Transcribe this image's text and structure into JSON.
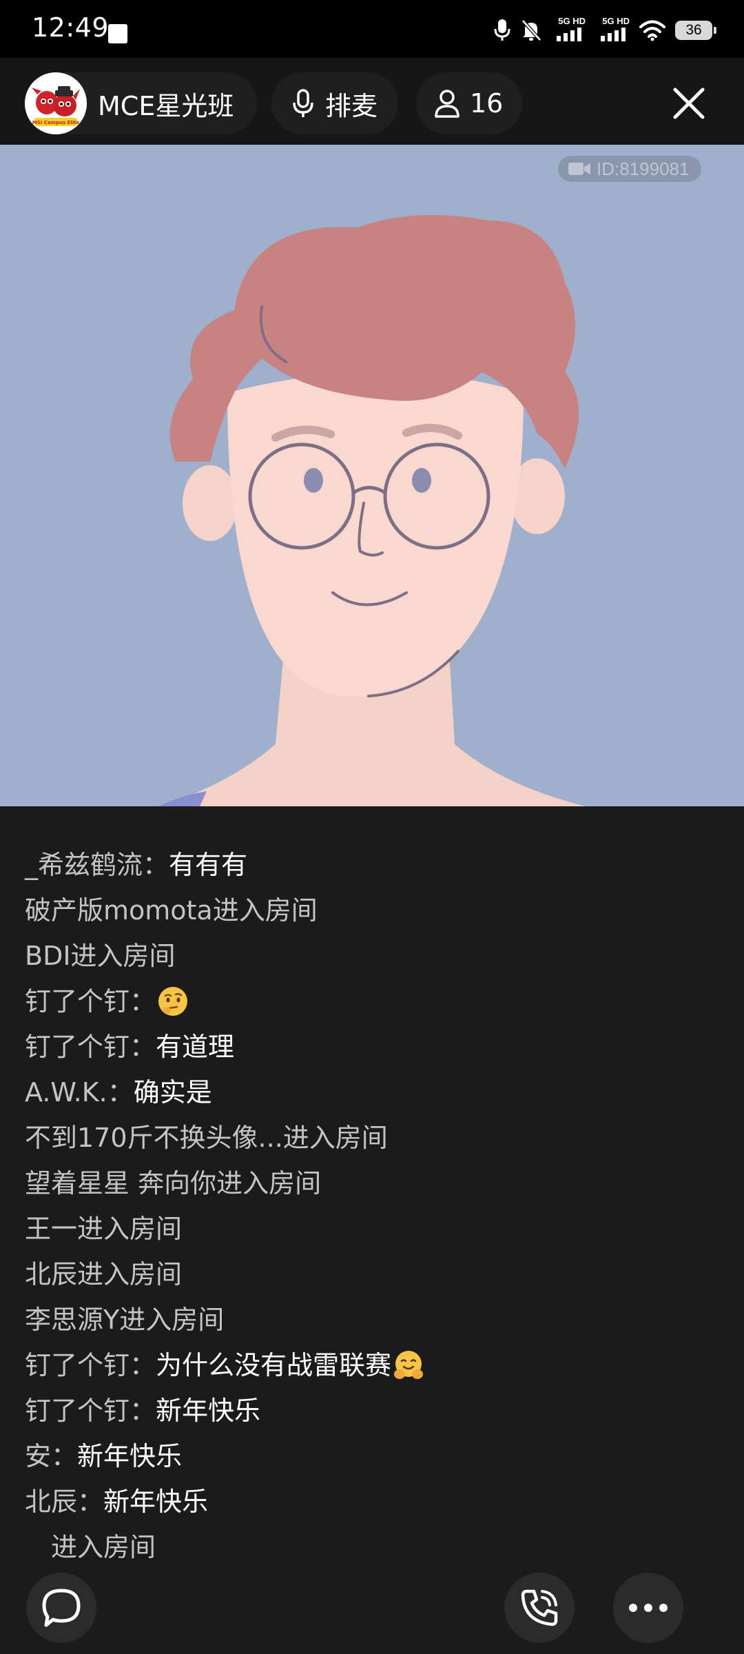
{
  "status_bar": {
    "time": "12:49",
    "network_1": "5G HD",
    "network_2": "5G HD",
    "battery": "36"
  },
  "header": {
    "room_name": "MCE星光班",
    "mic_label": "排麦",
    "member_count": "16",
    "avatar_caption": "MSI Campus Elite"
  },
  "video": {
    "id_label": "ID:8199081"
  },
  "chat": {
    "messages": [
      {
        "user": "_希兹鹤流",
        "sep": "：",
        "text": "有有有"
      },
      {
        "system": "破产版momota进入房间"
      },
      {
        "system": "BDI进入房间"
      },
      {
        "user": "钉了个钉",
        "sep": "：",
        "text": "",
        "emoji": "thinking-face"
      },
      {
        "user": "钉了个钉",
        "sep": "：",
        "text": "有道理"
      },
      {
        "user": "A.W.K.",
        "sep": "：",
        "text": "确实是"
      },
      {
        "system": "不到170斤不换头像...进入房间"
      },
      {
        "system": "望着星星 奔向你进入房间"
      },
      {
        "system": "王一进入房间"
      },
      {
        "system": "北辰进入房间"
      },
      {
        "system": "李思源Y进入房间"
      },
      {
        "user": "钉了个钉",
        "sep": "：",
        "text": "为什么没有战雷联赛",
        "emoji": "hugging-face"
      },
      {
        "user": "钉了个钉",
        "sep": "：",
        "text": "新年快乐"
      },
      {
        "user": "安",
        "sep": "：",
        "text": "新年快乐"
      },
      {
        "user": "北辰",
        "sep": "：",
        "text": "新年快乐"
      },
      {
        "system": "　进入房间"
      }
    ]
  },
  "toolbar": {
    "chat_icon": "chat-bubble-icon",
    "call_icon": "phone-call-icon",
    "more_icon": "more-dots-icon"
  },
  "colors": {
    "video_bg": "#9fb0cc",
    "chat_bg": "#1b1b1b",
    "header_bg": "#161616"
  }
}
